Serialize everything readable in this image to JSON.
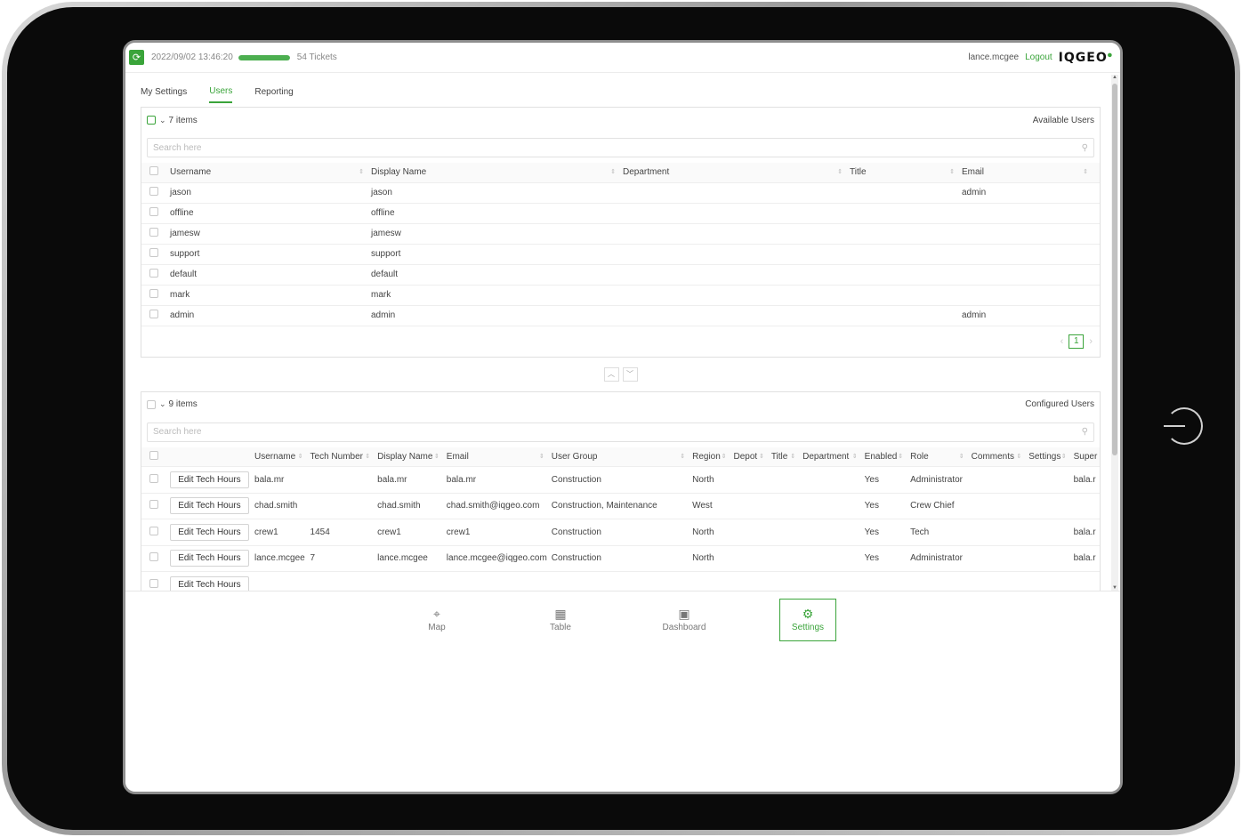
{
  "topbar": {
    "datetime": "2022/09/02 13:46:20",
    "progress_fraction": 1.0,
    "tickets": "54 Tickets",
    "username": "lance.mcgee",
    "logout": "Logout",
    "logo": "IQGEO"
  },
  "tabs": [
    {
      "label": "My Settings",
      "active": false
    },
    {
      "label": "Users",
      "active": true
    },
    {
      "label": "Reporting",
      "active": false
    }
  ],
  "available": {
    "count": "7 items",
    "title": "Available Users",
    "search_placeholder": "Search here",
    "columns": [
      "Username",
      "Display Name",
      "Department",
      "Title",
      "Email"
    ],
    "rows": [
      [
        "jason",
        "jason",
        "",
        "",
        "admin"
      ],
      [
        "offline",
        "offline",
        "",
        "",
        ""
      ],
      [
        "jamesw",
        "jamesw",
        "",
        "",
        ""
      ],
      [
        "support",
        "support",
        "",
        "",
        ""
      ],
      [
        "default",
        "default",
        "",
        "",
        ""
      ],
      [
        "mark",
        "mark",
        "",
        "",
        ""
      ],
      [
        "admin",
        "admin",
        "",
        "",
        "admin"
      ]
    ],
    "page": "1"
  },
  "configured": {
    "count": "9 items",
    "title": "Configured Users",
    "search_placeholder": "Search here",
    "edit_label": "Edit Tech Hours",
    "columns": [
      "Username",
      "Tech Number",
      "Display Name",
      "Email",
      "User Group",
      "Region",
      "Depot",
      "Title",
      "Department",
      "Enabled",
      "Role",
      "Comments",
      "Settings",
      "Super"
    ],
    "rows": [
      [
        "bala.mr",
        "",
        "bala.mr",
        "bala.mr",
        "Construction",
        "North",
        "",
        "",
        "",
        "Yes",
        "Administrator",
        "",
        "",
        "bala.r"
      ],
      [
        "chad.smith",
        "",
        "chad.smith",
        "chad.smith@iqgeo.com",
        "Construction, Maintenance",
        "West",
        "",
        "",
        "",
        "Yes",
        "Crew Chief",
        "",
        "",
        ""
      ],
      [
        "crew1",
        "1454",
        "crew1",
        "crew1",
        "Construction",
        "North",
        "",
        "",
        "",
        "Yes",
        "Tech",
        "",
        "",
        "bala.r"
      ],
      [
        "lance.mcgee",
        "7",
        "lance.mcgee",
        "lance.mcgee@iqgeo.com",
        "Construction",
        "North",
        "",
        "",
        "",
        "Yes",
        "Administrator",
        "",
        "",
        "bala.r"
      ],
      [
        "",
        "",
        "",
        "",
        "",
        "",
        "",
        "",
        "",
        "",
        "",
        "",
        "",
        ""
      ]
    ]
  },
  "nav": [
    {
      "label": "Map",
      "icon": "map-pin-icon",
      "active": false
    },
    {
      "label": "Table",
      "icon": "table-icon",
      "active": false
    },
    {
      "label": "Dashboard",
      "icon": "dashboard-icon",
      "active": false
    },
    {
      "label": "Settings",
      "icon": "gear-icon",
      "active": true
    }
  ],
  "colors": {
    "accent": "#3aa43a"
  }
}
